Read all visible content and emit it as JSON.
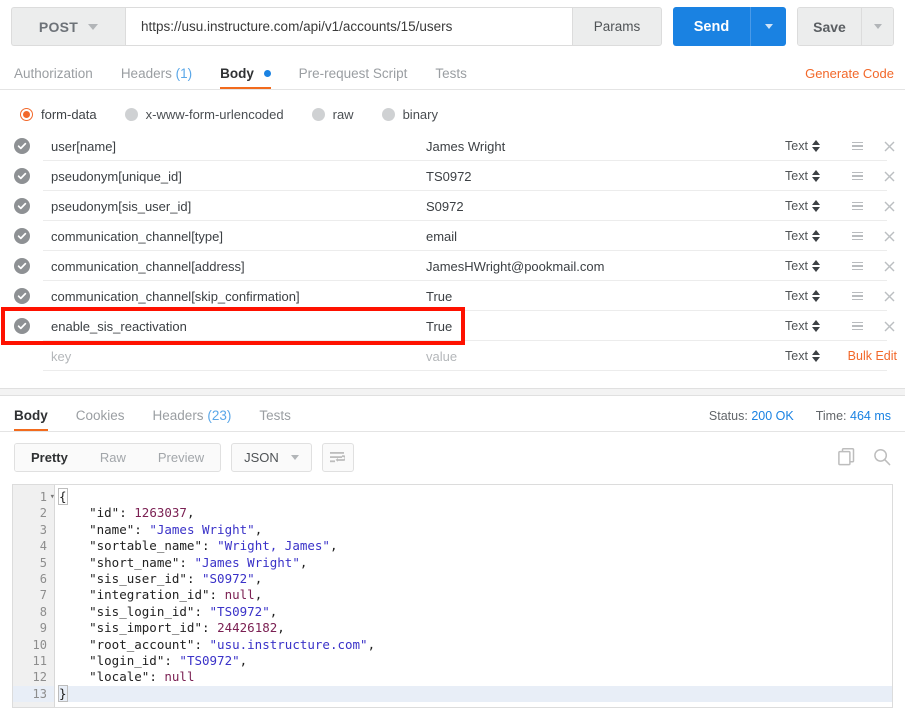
{
  "request": {
    "method": "POST",
    "url": "https://usu.instructure.com/api/v1/accounts/15/users",
    "params_label": "Params",
    "send_label": "Send",
    "save_label": "Save",
    "tabs": [
      {
        "label": "Authorization",
        "active": false,
        "count": ""
      },
      {
        "label": "Headers",
        "active": false,
        "count": "(1)"
      },
      {
        "label": "Body",
        "active": true,
        "count": ""
      },
      {
        "label": "Pre-request Script",
        "active": false,
        "count": ""
      },
      {
        "label": "Tests",
        "active": false,
        "count": ""
      }
    ],
    "generate_code": "Generate Code"
  },
  "body_types": [
    {
      "label": "form-data",
      "selected": true
    },
    {
      "label": "x-www-form-urlencoded",
      "selected": false
    },
    {
      "label": "raw",
      "selected": false
    },
    {
      "label": "binary",
      "selected": false
    }
  ],
  "form_data": {
    "type_label": "Text",
    "bulk_edit_label": "Bulk Edit",
    "key_placeholder": "key",
    "value_placeholder": "value",
    "rows": [
      {
        "key": "user[name]",
        "value": "James Wright",
        "type": "Text",
        "checked": true,
        "highlighted": false
      },
      {
        "key": "pseudonym[unique_id]",
        "value": "TS0972",
        "type": "Text",
        "checked": true,
        "highlighted": false
      },
      {
        "key": "pseudonym[sis_user_id]",
        "value": "S0972",
        "type": "Text",
        "checked": true,
        "highlighted": false
      },
      {
        "key": "communication_channel[type]",
        "value": "email",
        "type": "Text",
        "checked": true,
        "highlighted": false
      },
      {
        "key": "communication_channel[address]",
        "value": "JamesHWright@pookmail.com",
        "type": "Text",
        "checked": true,
        "highlighted": false
      },
      {
        "key": "communication_channel[skip_confirmation]",
        "value": "True",
        "type": "Text",
        "checked": true,
        "highlighted": false
      },
      {
        "key": "enable_sis_reactivation",
        "value": "True",
        "type": "Text",
        "checked": true,
        "highlighted": true
      }
    ]
  },
  "response": {
    "tabs": [
      {
        "label": "Body",
        "active": true,
        "count": ""
      },
      {
        "label": "Cookies",
        "active": false,
        "count": ""
      },
      {
        "label": "Headers",
        "active": false,
        "count": "(23)"
      },
      {
        "label": "Tests",
        "active": false,
        "count": ""
      }
    ],
    "status_label": "Status:",
    "status_value": "200 OK",
    "time_label": "Time:",
    "time_value": "464 ms",
    "view_modes": [
      {
        "label": "Pretty",
        "active": true
      },
      {
        "label": "Raw",
        "active": false
      },
      {
        "label": "Preview",
        "active": false
      }
    ],
    "format": "JSON",
    "icons": {
      "wrap": "word-wrap-icon",
      "copy": "copy-icon",
      "search": "search-icon"
    },
    "json_lines": [
      {
        "n": 1,
        "fold": true,
        "current": false,
        "tokens": [
          {
            "t": "{",
            "c": "punct"
          }
        ]
      },
      {
        "n": 2,
        "fold": false,
        "current": false,
        "tokens": [
          {
            "t": "    \"id\"",
            "c": "key"
          },
          {
            "t": ": ",
            "c": "punct"
          },
          {
            "t": "1263037",
            "c": "num"
          },
          {
            "t": ",",
            "c": "punct"
          }
        ]
      },
      {
        "n": 3,
        "fold": false,
        "current": false,
        "tokens": [
          {
            "t": "    \"name\"",
            "c": "key"
          },
          {
            "t": ": ",
            "c": "punct"
          },
          {
            "t": "\"James Wright\"",
            "c": "str"
          },
          {
            "t": ",",
            "c": "punct"
          }
        ]
      },
      {
        "n": 4,
        "fold": false,
        "current": false,
        "tokens": [
          {
            "t": "    \"sortable_name\"",
            "c": "key"
          },
          {
            "t": ": ",
            "c": "punct"
          },
          {
            "t": "\"Wright, James\"",
            "c": "str"
          },
          {
            "t": ",",
            "c": "punct"
          }
        ]
      },
      {
        "n": 5,
        "fold": false,
        "current": false,
        "tokens": [
          {
            "t": "    \"short_name\"",
            "c": "key"
          },
          {
            "t": ": ",
            "c": "punct"
          },
          {
            "t": "\"James Wright\"",
            "c": "str"
          },
          {
            "t": ",",
            "c": "punct"
          }
        ]
      },
      {
        "n": 6,
        "fold": false,
        "current": false,
        "tokens": [
          {
            "t": "    \"sis_user_id\"",
            "c": "key"
          },
          {
            "t": ": ",
            "c": "punct"
          },
          {
            "t": "\"S0972\"",
            "c": "str"
          },
          {
            "t": ",",
            "c": "punct"
          }
        ]
      },
      {
        "n": 7,
        "fold": false,
        "current": false,
        "tokens": [
          {
            "t": "    \"integration_id\"",
            "c": "key"
          },
          {
            "t": ": ",
            "c": "punct"
          },
          {
            "t": "null",
            "c": "null"
          },
          {
            "t": ",",
            "c": "punct"
          }
        ]
      },
      {
        "n": 8,
        "fold": false,
        "current": false,
        "tokens": [
          {
            "t": "    \"sis_login_id\"",
            "c": "key"
          },
          {
            "t": ": ",
            "c": "punct"
          },
          {
            "t": "\"TS0972\"",
            "c": "str"
          },
          {
            "t": ",",
            "c": "punct"
          }
        ]
      },
      {
        "n": 9,
        "fold": false,
        "current": false,
        "tokens": [
          {
            "t": "    \"sis_import_id\"",
            "c": "key"
          },
          {
            "t": ": ",
            "c": "punct"
          },
          {
            "t": "24426182",
            "c": "num"
          },
          {
            "t": ",",
            "c": "punct"
          }
        ]
      },
      {
        "n": 10,
        "fold": false,
        "current": false,
        "tokens": [
          {
            "t": "    \"root_account\"",
            "c": "key"
          },
          {
            "t": ": ",
            "c": "punct"
          },
          {
            "t": "\"usu.instructure.com\"",
            "c": "str"
          },
          {
            "t": ",",
            "c": "punct"
          }
        ]
      },
      {
        "n": 11,
        "fold": false,
        "current": false,
        "tokens": [
          {
            "t": "    \"login_id\"",
            "c": "key"
          },
          {
            "t": ": ",
            "c": "punct"
          },
          {
            "t": "\"TS0972\"",
            "c": "str"
          },
          {
            "t": ",",
            "c": "punct"
          }
        ]
      },
      {
        "n": 12,
        "fold": false,
        "current": false,
        "tokens": [
          {
            "t": "    \"locale\"",
            "c": "key"
          },
          {
            "t": ": ",
            "c": "punct"
          },
          {
            "t": "null",
            "c": "null"
          }
        ]
      },
      {
        "n": 13,
        "fold": false,
        "current": true,
        "tokens": [
          {
            "t": "}",
            "c": "punct"
          }
        ]
      }
    ]
  },
  "colors": {
    "accent_orange": "#f2682a",
    "send_blue": "#1a82e2",
    "highlight_red": "#fe1100",
    "json_string": "#3a32c8",
    "json_number": "#7a1f52"
  }
}
